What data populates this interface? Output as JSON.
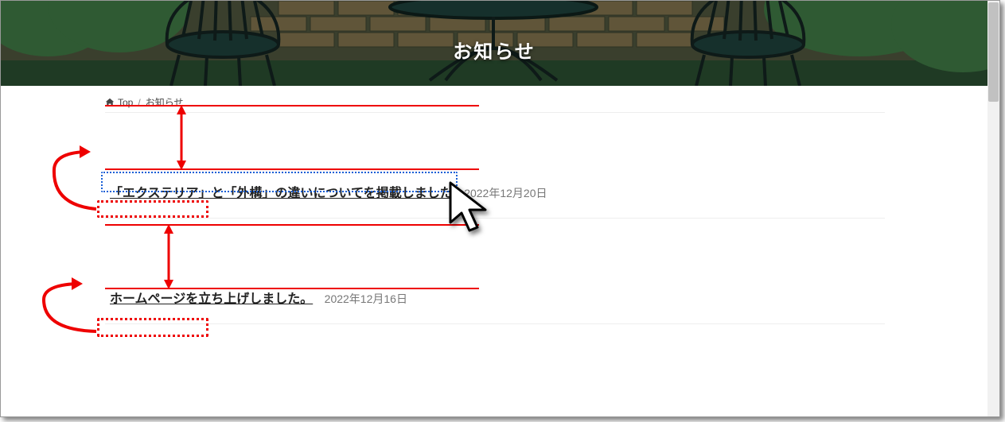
{
  "hero": {
    "title": "お知らせ"
  },
  "breadcrumb": {
    "home_label": "Top",
    "current": "お知らせ"
  },
  "articles": [
    {
      "title": "「エクステリア」と「外構」の違いについてを掲載しました",
      "date": "2022年12月20日"
    },
    {
      "title": "ホームページを立ち上げしました。",
      "date": "2022年12月16日"
    }
  ]
}
